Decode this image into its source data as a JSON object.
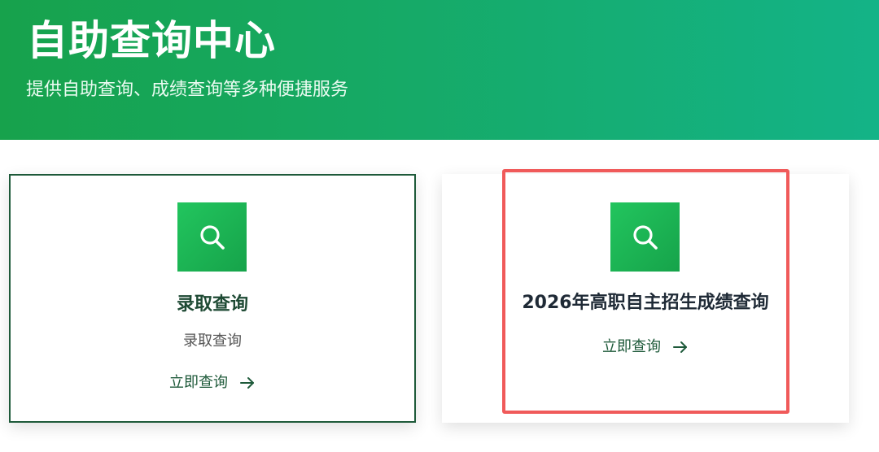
{
  "hero": {
    "title": "自助查询中心",
    "subtitle": "提供自助查询、成绩查询等多种便捷服务"
  },
  "cards": [
    {
      "icon": "search-icon",
      "title": "录取查询",
      "description": "录取查询",
      "link_label": "立即查询"
    },
    {
      "icon": "search-icon",
      "title": "2026年高职自主招生成绩查询",
      "link_label": "立即查询"
    }
  ],
  "colors": {
    "brand_green": "#16a34a",
    "hero_gradient_start": "#17a24c",
    "hero_gradient_end": "#14b387",
    "highlight_red": "#f05a5a",
    "card_border": "#1e5a3a"
  }
}
